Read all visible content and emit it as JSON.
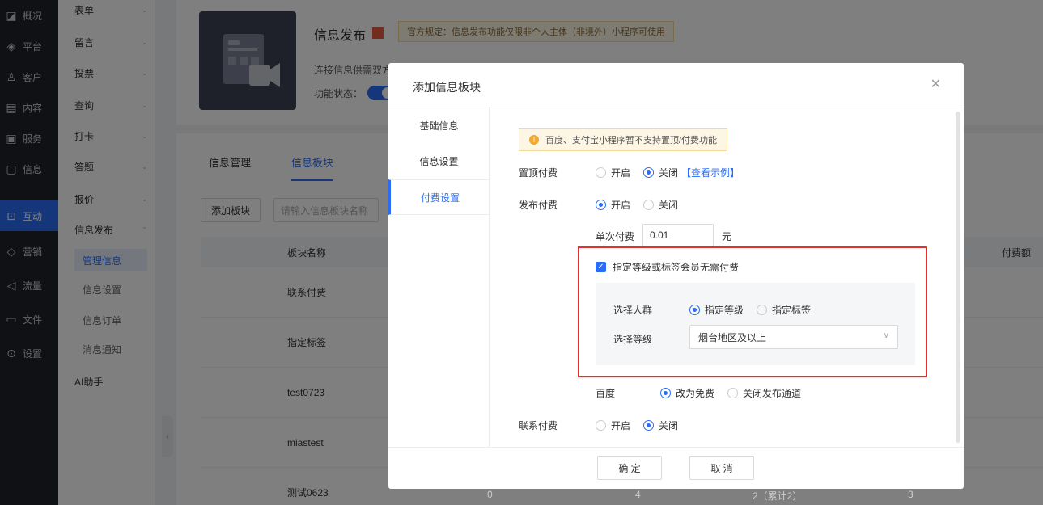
{
  "sidebar": {
    "items": [
      {
        "label": "概况",
        "icon": "chart-icon"
      },
      {
        "label": "平台",
        "icon": "layers-icon"
      },
      {
        "label": "客户",
        "icon": "user-icon"
      },
      {
        "label": "内容",
        "icon": "document-icon"
      },
      {
        "label": "服务",
        "icon": "service-icon"
      },
      {
        "label": "信息",
        "icon": "message-icon"
      },
      {
        "label": "互动",
        "icon": "interaction-icon"
      },
      {
        "label": "营销",
        "icon": "tag-icon"
      },
      {
        "label": "流量",
        "icon": "megaphone-icon"
      },
      {
        "label": "文件",
        "icon": "folder-icon"
      },
      {
        "label": "设置",
        "icon": "gear-icon"
      }
    ]
  },
  "submenu": {
    "items": [
      "表单",
      "留言",
      "投票",
      "查询",
      "打卡",
      "答题",
      "报价",
      "信息发布"
    ],
    "children": [
      "管理信息",
      "信息设置",
      "信息订单",
      "消息通知"
    ],
    "ai": "AI助手"
  },
  "app": {
    "title": "信息发布",
    "notice": "官方规定：信息发布功能仅限非个人主体（非境外）小程序可使用",
    "desc": "连接信息供需双方",
    "status_label": "功能状态："
  },
  "list": {
    "tabs": [
      "信息管理",
      "信息板块"
    ],
    "add_button": "添加板块",
    "search_placeholder": "请输入信息板块名称",
    "col_name": "板块名称",
    "col_right": "付费额",
    "rows": [
      "联系付费",
      "指定标签",
      "test0723",
      "miastest",
      "测试0623"
    ],
    "last_row_values": [
      "0",
      "4",
      "2（累计2）",
      "3"
    ]
  },
  "dialog": {
    "title": "添加信息板块",
    "nav": [
      "基础信息",
      "信息设置",
      "付费设置"
    ],
    "warning": "百度、支付宝小程序暂不支持置顶/付费功能",
    "top_pay": {
      "label": "置顶付费",
      "on": "开启",
      "off": "关闭",
      "link": "【查看示例】"
    },
    "publish_pay": {
      "label": "发布付费",
      "on": "开启",
      "off": "关闭"
    },
    "single_pay": {
      "label": "单次付费",
      "value": "0.01",
      "unit": "元"
    },
    "member_free": "指定等级或标签会员无需付费",
    "crowd": {
      "label": "选择人群",
      "opt1": "指定等级",
      "opt2": "指定标签"
    },
    "level": {
      "label": "选择等级",
      "value": "烟台地区及以上"
    },
    "baidu": {
      "label": "百度",
      "opt1": "改为免费",
      "opt2": "关闭发布通道"
    },
    "contact_pay": {
      "label": "联系付费",
      "on": "开启",
      "off": "关闭"
    },
    "confirm": "确 定",
    "cancel": "取 消"
  }
}
